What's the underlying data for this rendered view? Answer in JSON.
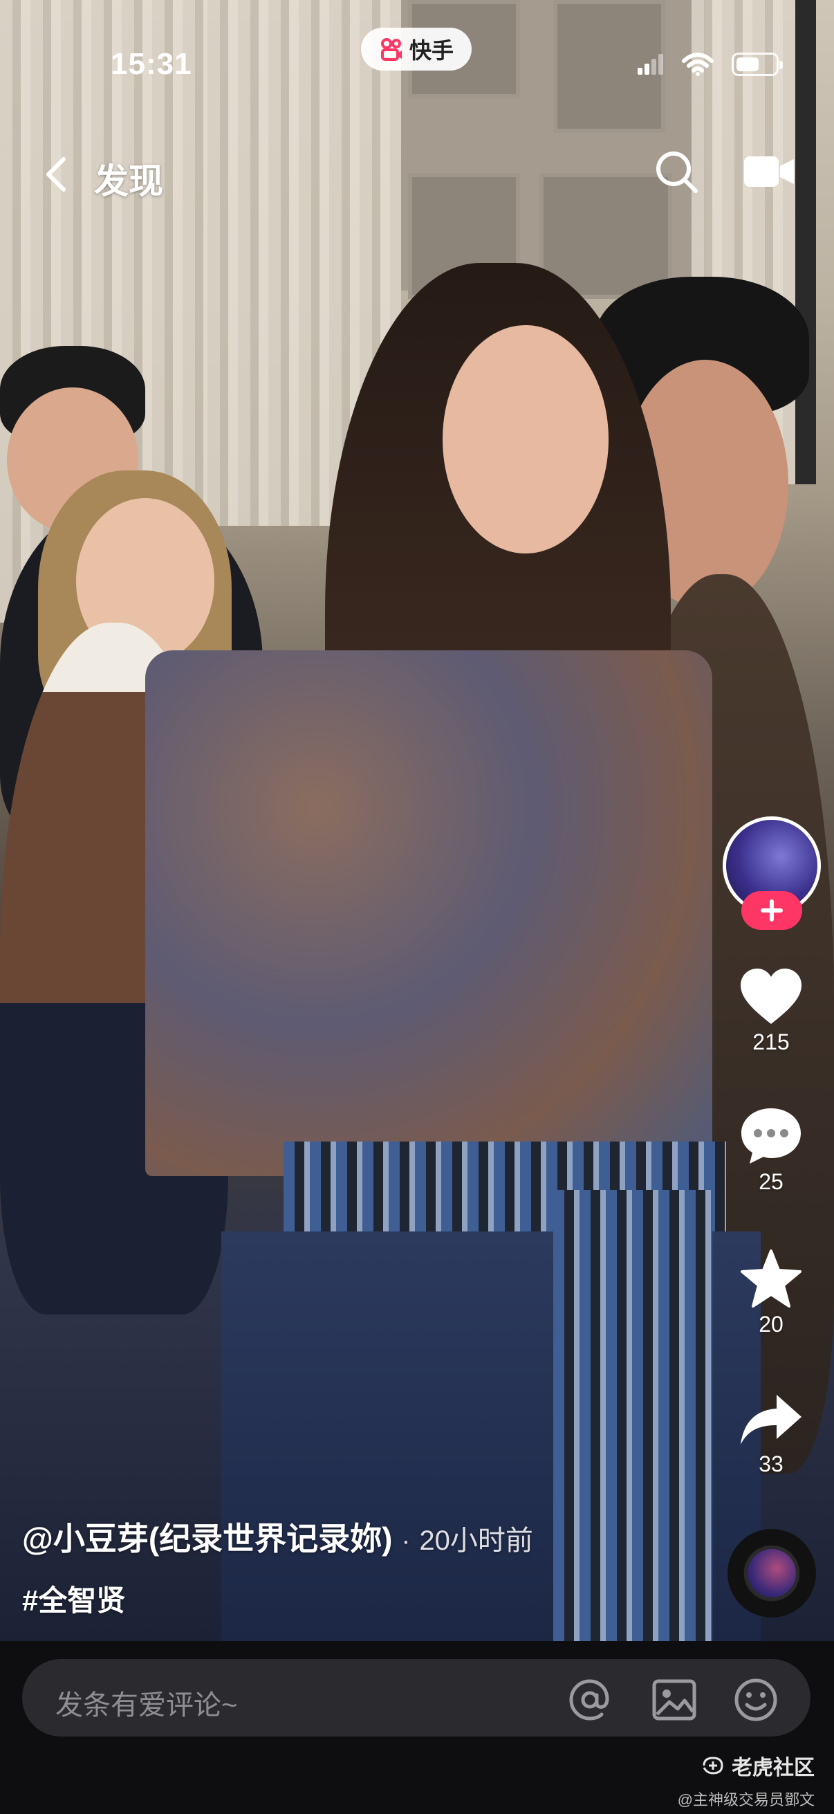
{
  "status_bar": {
    "time": "15:31",
    "app_pill": "快手",
    "battery_level": 0.6
  },
  "nav": {
    "title": "发现"
  },
  "post": {
    "author": "@小豆芽(纪录世界记录妳)",
    "separator": "·",
    "time_ago": "20小时前",
    "hashtag": "#全智贤"
  },
  "actions": {
    "likes": "215",
    "comments": "25",
    "favorites": "20",
    "shares": "33"
  },
  "comment_bar": {
    "placeholder": "发条有爱评论~"
  },
  "watermark": {
    "brand": "老虎社区",
    "author": "@主神级交易员鄧文"
  },
  "icons": [
    "back-icon",
    "search-icon",
    "camera-icon",
    "follow-plus-icon",
    "heart-icon",
    "comment-bubble-icon",
    "star-icon",
    "share-arrow-icon",
    "music-disc-icon",
    "at-icon",
    "image-icon",
    "emoji-icon"
  ]
}
